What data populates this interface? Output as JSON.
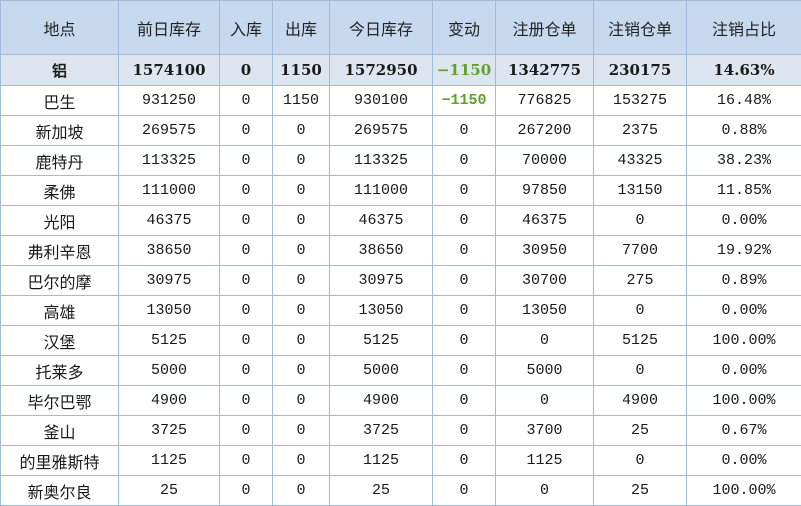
{
  "colors": {
    "header_bg": "#c6d9ef",
    "total_bg": "#dde6f0",
    "negative": "#5fa12a",
    "border": "#9fbbd6"
  },
  "headers": [
    "地点",
    "前日库存",
    "入库",
    "出库",
    "今日库存",
    "变动",
    "注册仓单",
    "注销仓单",
    "注销占比"
  ],
  "total": [
    "铝",
    "1574100",
    "0",
    "1150",
    "1572950",
    "−1150",
    "1342775",
    "230175",
    "14.63%"
  ],
  "rows": [
    [
      "巴生",
      "931250",
      "0",
      "1150",
      "930100",
      "−1150",
      "776825",
      "153275",
      "16.48%"
    ],
    [
      "新加坡",
      "269575",
      "0",
      "0",
      "269575",
      "0",
      "267200",
      "2375",
      "0.88%"
    ],
    [
      "鹿特丹",
      "113325",
      "0",
      "0",
      "113325",
      "0",
      "70000",
      "43325",
      "38.23%"
    ],
    [
      "柔佛",
      "111000",
      "0",
      "0",
      "111000",
      "0",
      "97850",
      "13150",
      "11.85%"
    ],
    [
      "光阳",
      "46375",
      "0",
      "0",
      "46375",
      "0",
      "46375",
      "0",
      "0.00%"
    ],
    [
      "弗利辛恩",
      "38650",
      "0",
      "0",
      "38650",
      "0",
      "30950",
      "7700",
      "19.92%"
    ],
    [
      "巴尔的摩",
      "30975",
      "0",
      "0",
      "30975",
      "0",
      "30700",
      "275",
      "0.89%"
    ],
    [
      "高雄",
      "13050",
      "0",
      "0",
      "13050",
      "0",
      "13050",
      "0",
      "0.00%"
    ],
    [
      "汉堡",
      "5125",
      "0",
      "0",
      "5125",
      "0",
      "0",
      "5125",
      "100.00%"
    ],
    [
      "托莱多",
      "5000",
      "0",
      "0",
      "5000",
      "0",
      "5000",
      "0",
      "0.00%"
    ],
    [
      "毕尔巴鄂",
      "4900",
      "0",
      "0",
      "4900",
      "0",
      "0",
      "4900",
      "100.00%"
    ],
    [
      "釜山",
      "3725",
      "0",
      "0",
      "3725",
      "0",
      "3700",
      "25",
      "0.67%"
    ],
    [
      "的里雅斯特",
      "1125",
      "0",
      "0",
      "1125",
      "0",
      "1125",
      "0",
      "0.00%"
    ],
    [
      "新奥尔良",
      "25",
      "0",
      "0",
      "25",
      "0",
      "0",
      "25",
      "100.00%"
    ]
  ]
}
